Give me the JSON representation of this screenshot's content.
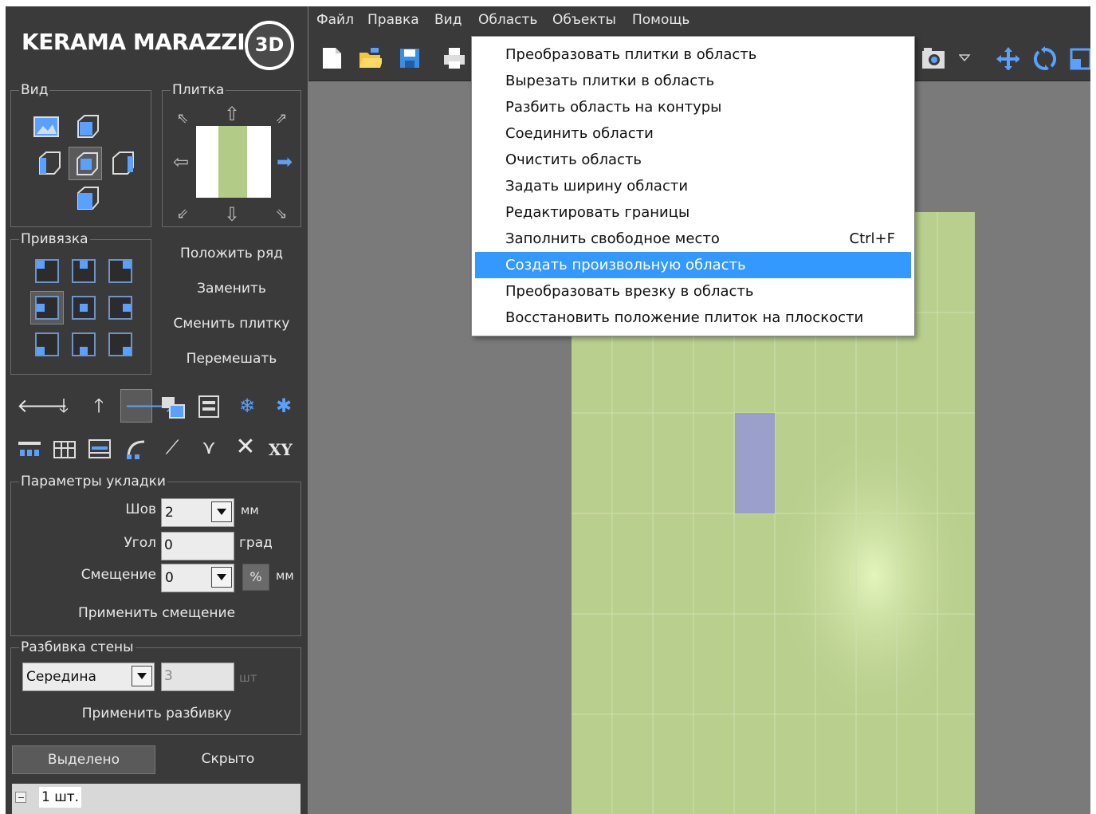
{
  "logo": {
    "brand": "KERAMA MARAZZI",
    "badge": "3D"
  },
  "menubar": [
    "Файл",
    "Правка",
    "Вид",
    "Область",
    "Объекты",
    "Помощь"
  ],
  "left": {
    "view_title": "Вид",
    "tile_title": "Плитка",
    "snap_title": "Привязка",
    "actions": [
      "Положить ряд",
      "Заменить",
      "Сменить плитку",
      "Перемешать"
    ],
    "xy_label": "XY",
    "params": {
      "title": "Параметры укладки",
      "seam_label": "Шов",
      "seam_value": "2",
      "seam_unit": "мм",
      "angle_label": "Угол",
      "angle_value": "0",
      "angle_unit": "град",
      "offset_label": "Смещение",
      "offset_value": "0",
      "offset_pct": "%",
      "offset_unit": "мм",
      "apply_offset": "Применить смещение"
    },
    "wall": {
      "title": "Разбивка стены",
      "mode_value": "Середина",
      "count_value": "3",
      "count_unit": "шт",
      "apply": "Применить разбивку"
    },
    "tabs": [
      "Выделено",
      "Скрыто"
    ],
    "tree_item": "1 шт."
  },
  "dropdown_menu": {
    "items": [
      {
        "label": "Преобразовать плитки в область",
        "shortcut": ""
      },
      {
        "label": "Вырезать плитки в область",
        "shortcut": ""
      },
      {
        "label": "Разбить область на контуры",
        "shortcut": ""
      },
      {
        "label": "Соединить области",
        "shortcut": ""
      },
      {
        "label": "Очистить область",
        "shortcut": ""
      },
      {
        "label": "Задать ширину области",
        "shortcut": ""
      },
      {
        "label": "Редактировать границы",
        "shortcut": ""
      },
      {
        "label": "Заполнить свободное место",
        "shortcut": "Ctrl+F"
      },
      {
        "label": "Создать произвольную область",
        "shortcut": ""
      },
      {
        "label": "Преобразовать врезку в область",
        "shortcut": ""
      },
      {
        "label": "Восстановить положение плиток на плоскости",
        "shortcut": ""
      }
    ],
    "selected_index": 8
  },
  "colors": {
    "accent": "#3399ff",
    "panel": "#3a3a3a",
    "canvas": "#7a7a7a",
    "tile": "#b9cf8e",
    "selected_tile": "#9aa0c9"
  }
}
